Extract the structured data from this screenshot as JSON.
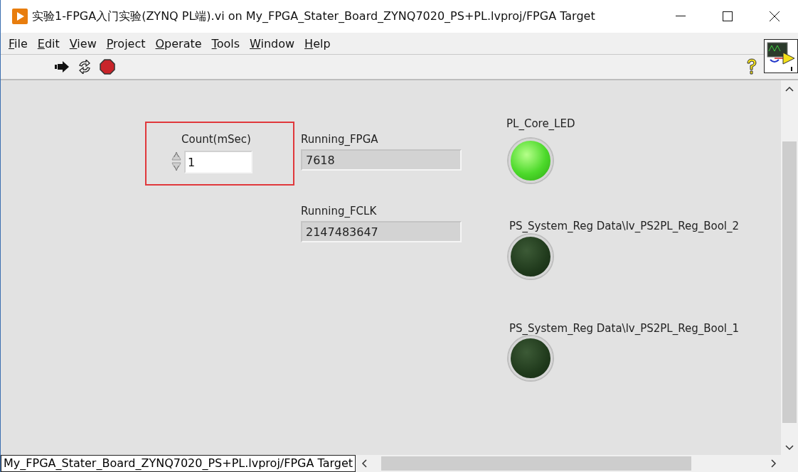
{
  "window": {
    "title": "实验1-FPGA入门实验(ZYNQ PL端).vi on My_FPGA_Stater_Board_ZYNQ7020_PS+PL.lvproj/FPGA Target"
  },
  "menu": [
    "File",
    "Edit",
    "View",
    "Project",
    "Operate",
    "Tools",
    "Window",
    "Help"
  ],
  "panel": {
    "controls": [
      {
        "kind": "numeric_control",
        "label": "Count(mSec)",
        "value": "1",
        "highlighted": true
      },
      {
        "kind": "numeric_indicator",
        "label": "Running_FPGA",
        "value": "7618"
      },
      {
        "kind": "numeric_indicator",
        "label": "Running_FCLK",
        "value": "2147483647"
      },
      {
        "kind": "led",
        "label": "PL_Core_LED",
        "on": true
      },
      {
        "kind": "led",
        "label": "PS_System_Reg Data\\lv_PS2PL_Reg_Bool_2",
        "on": false
      },
      {
        "kind": "led",
        "label": "PS_System_Reg Data\\lv_PS2PL_Reg_Bool_1",
        "on": false
      }
    ]
  },
  "status_bar": {
    "text": "My_FPGA_Stater_Board_ZYNQ7020_PS+PL.lvproj/FPGA Target"
  }
}
